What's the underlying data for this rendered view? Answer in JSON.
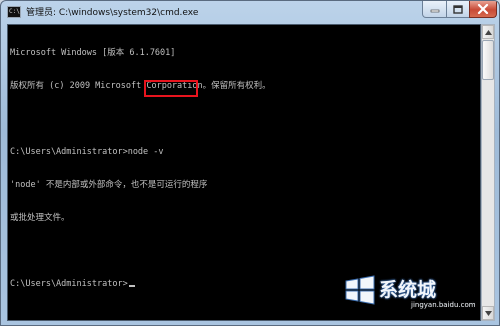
{
  "window": {
    "icon_text": "C:\\",
    "title": "管理员: C:\\windows\\system32\\cmd.exe"
  },
  "controls": {
    "minimize_icon": "minimize-icon",
    "maximize_icon": "maximize-icon",
    "close_icon": "close-icon"
  },
  "console": {
    "lines": [
      "Microsoft Windows [版本 6.1.7601]",
      "版权所有 (c) 2009 Microsoft Corporation。保留所有权利。",
      "",
      "C:\\Users\\Administrator>node -v",
      "'node' 不是内部或外部命令，也不是可运行的程序",
      "或批处理文件。",
      "",
      "C:\\Users\\Administrator>"
    ]
  },
  "highlight_color": "#e8141e",
  "watermark": {
    "brand": "系统城",
    "url": "jingyan.baidu.com"
  }
}
